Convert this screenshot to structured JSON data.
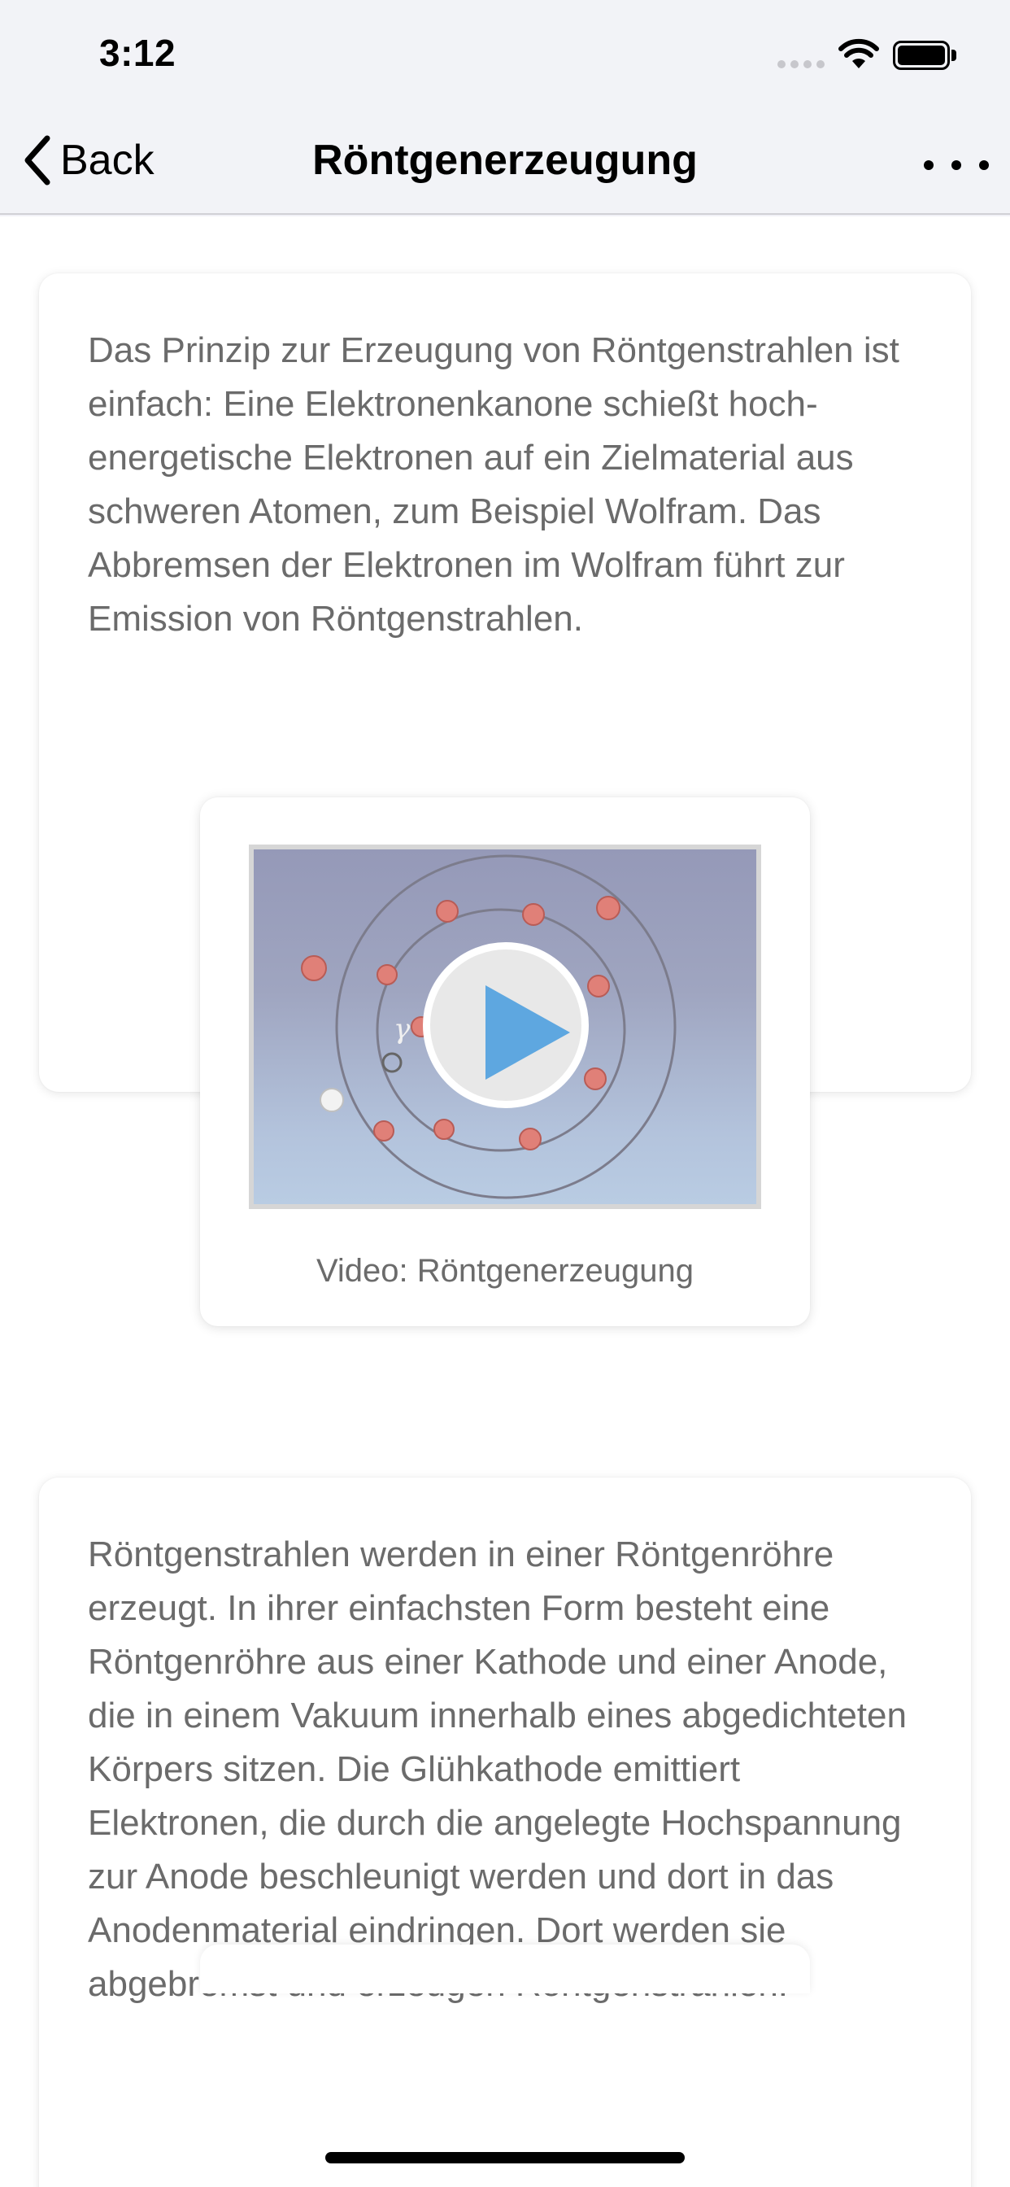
{
  "status_bar": {
    "time": "3:12"
  },
  "nav": {
    "back_label": "Back",
    "title": "Röntgenerzeugung"
  },
  "card1": {
    "text": "Das Prinzip zur Erzeugung von Röntgenstrahlen ist einfach: Eine Elektronenkanone schießt hoch-energetische Elektronen auf ein Zielmaterial aus schweren Atomen, zum Beispiel Wolfram. Das Abbremsen der Elektronen im Wolfram führt zur Emission von Röntgenstrahlen.",
    "video": {
      "caption": "Video: Röntgenerzeugung",
      "symbol": "γ",
      "icon": "play-icon"
    }
  },
  "card2": {
    "text": "Röntgenstrahlen werden in einer Röntgenröhre erzeugt. In ihrer einfachsten Form besteht eine Röntgenröhre aus einer Kathode und einer Anode, die in einem Vakuum innerhalb eines abgedichteten Körpers sitzen. Die Glühkathode emittiert Elektronen, die durch die angelegte Hochspannung zur Anode beschleunigt werden und dort in das Anodenmaterial eindringen. Dort werden sie abgebremst und erzeugen Röntgenstrahlen."
  },
  "colors": {
    "accent_play": "#5ea7e0",
    "text_gray": "#6b6b6b",
    "electron": "#e08078"
  }
}
